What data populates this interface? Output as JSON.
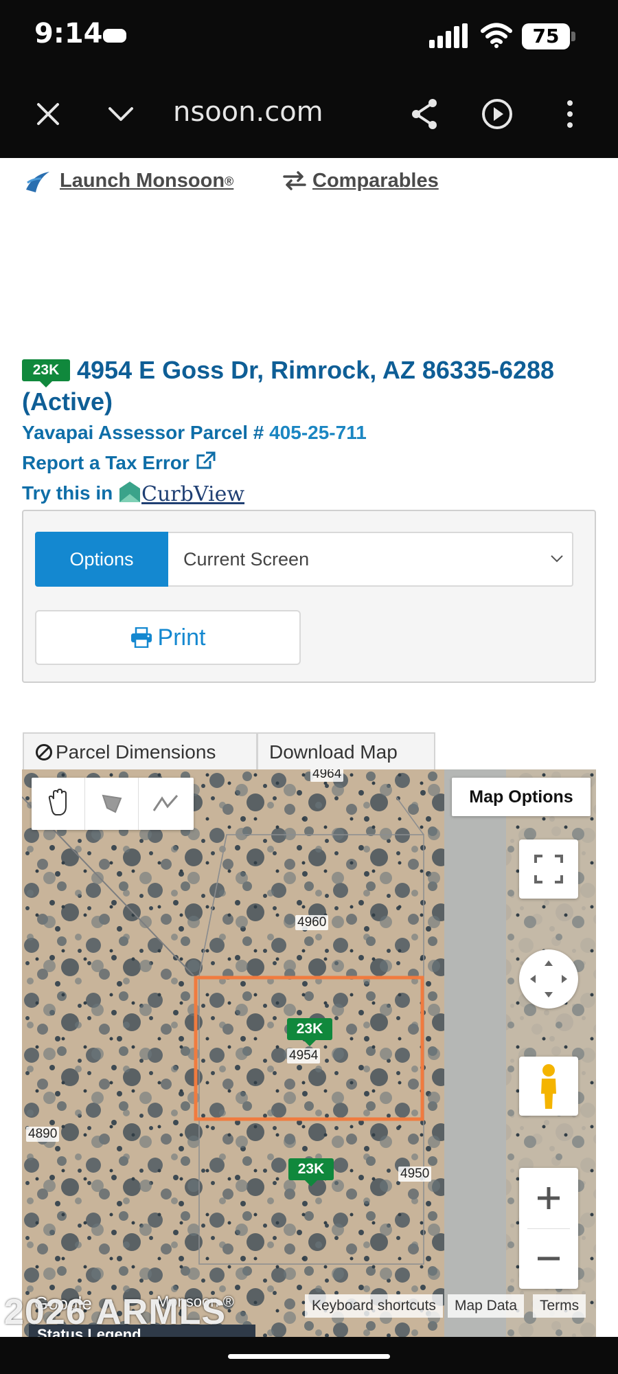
{
  "status_bar": {
    "time": "9:14",
    "battery": "75"
  },
  "browser": {
    "url": "nsoon.com"
  },
  "top_links": {
    "launch": "Launch Monsoon",
    "launch_mark": "®",
    "comparables": "Comparables"
  },
  "property": {
    "badge": "23K",
    "title": "4954 E Goss Dr, Rimrock, AZ 86335-6288 (Active)",
    "parcel_label": "Yavapai Assessor Parcel #",
    "parcel_number": "405-25-711",
    "tax_error": "Report a Tax Error",
    "try_label": "Try this in",
    "curbview": "CurbView"
  },
  "options": {
    "tab": "Options",
    "selected": "Current Screen",
    "print": "Print"
  },
  "map_tabs": {
    "parcel_dimensions": "Parcel Dimensions",
    "download_map": "Download Map"
  },
  "map": {
    "map_options": "Map Options",
    "labels": {
      "top": "4964",
      "north": "4960",
      "subject": "4954",
      "west": "4890",
      "east": "4950"
    },
    "badge_subject": "23K",
    "badge_south": "23K",
    "attribution": {
      "google": "Google",
      "monsoon": "Monsoon ®",
      "shortcuts": "Keyboard shortcuts",
      "map_data": "Map Data",
      "terms": "Terms"
    },
    "legend": "Status Legend",
    "watermark": "2026 ARMLS"
  }
}
